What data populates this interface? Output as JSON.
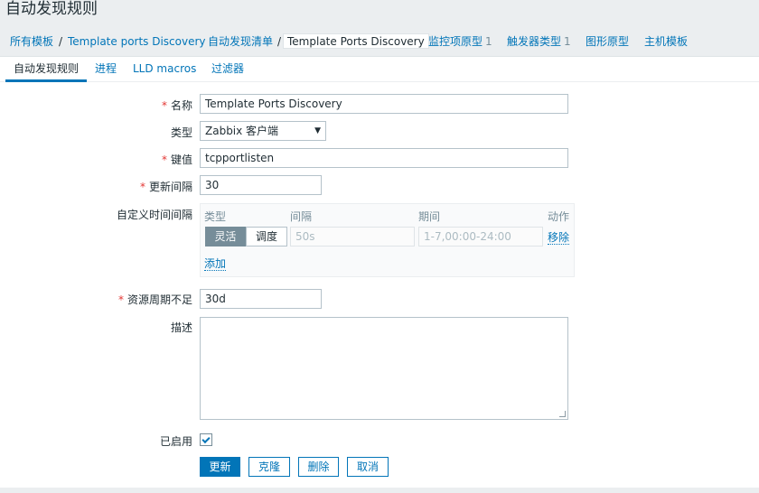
{
  "page": {
    "title": "自动发现规则"
  },
  "breadcrumbs": [
    {
      "label": "所有模板"
    },
    {
      "label": "Template ports Discovery"
    },
    {
      "label": "自动发现清单"
    },
    {
      "label": "Template Ports Discovery"
    },
    {
      "label": "监控项原型",
      "count": "1"
    },
    {
      "label": "触发器类型",
      "count": "1"
    },
    {
      "label": "图形原型"
    },
    {
      "label": "主机模板"
    }
  ],
  "tabs": [
    {
      "label": "自动发现规则",
      "selected": true
    },
    {
      "label": "进程"
    },
    {
      "label": "LLD macros"
    },
    {
      "label": "过滤器"
    }
  ],
  "form": {
    "name": {
      "label": "名称",
      "value": "Template Ports Discovery"
    },
    "type": {
      "label": "类型",
      "value": "Zabbix 客户端"
    },
    "key": {
      "label": "键值",
      "value": "tcpportlisten"
    },
    "interval": {
      "label": "更新间隔",
      "value": "30"
    },
    "custom_intervals": {
      "label": "自定义时间间隔",
      "columns": {
        "type": "类型",
        "interval": "间隔",
        "period": "期间",
        "action": "动作"
      },
      "row": {
        "mode_flexible": "灵活",
        "mode_scheduling": "调度",
        "interval_placeholder": "50s",
        "period_placeholder": "1-7,00:00-24:00",
        "remove": "移除"
      },
      "add": "添加"
    },
    "lifetime": {
      "label": "资源周期不足",
      "value": "30d"
    },
    "description": {
      "label": "描述",
      "value": ""
    },
    "enabled": {
      "label": "已启用",
      "checked": true
    }
  },
  "buttons": {
    "update": "更新",
    "clone": "克隆",
    "delete": "删除",
    "cancel": "取消"
  },
  "colors": {
    "accent": "#0275b8",
    "required": "#e33734",
    "bg": "#ebeef0"
  }
}
